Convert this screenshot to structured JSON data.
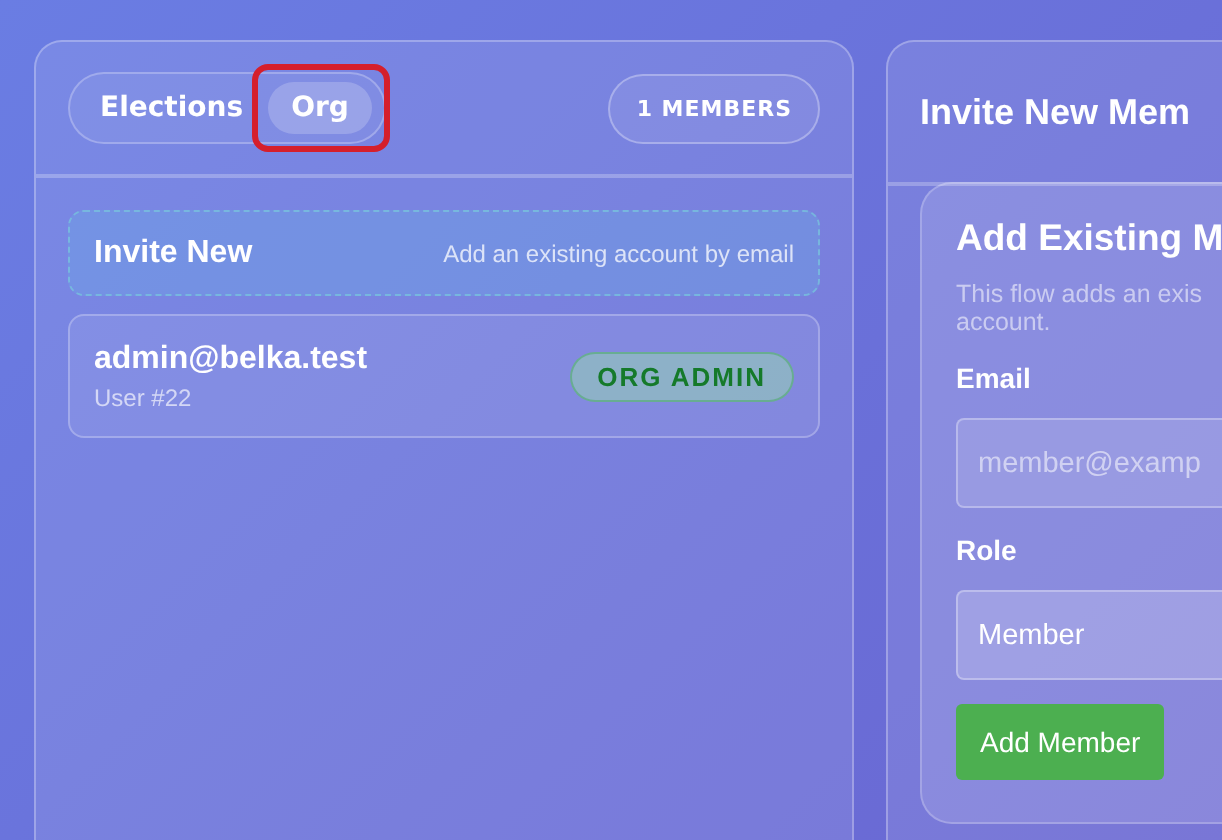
{
  "left_panel": {
    "tabs": [
      {
        "label": "Elections",
        "selected": false,
        "highlighted": false
      },
      {
        "label": "Org",
        "selected": true,
        "highlighted": true
      }
    ],
    "member_count": "1 MEMBERS",
    "invite_row": {
      "title": "Invite New",
      "hint": "Add an existing account by email"
    },
    "members": [
      {
        "email": "admin@belka.test",
        "user": "User #22",
        "role": "ORG ADMIN"
      }
    ]
  },
  "right_panel": {
    "title": "Invite New Mem",
    "card": {
      "title": "Add Existing M",
      "description_lines": [
        "This flow adds an exis",
        "account."
      ],
      "email_label": "Email",
      "email_placeholder": "member@examp",
      "role_label": "Role",
      "role_value": "Member",
      "button": "Add Member"
    }
  }
}
